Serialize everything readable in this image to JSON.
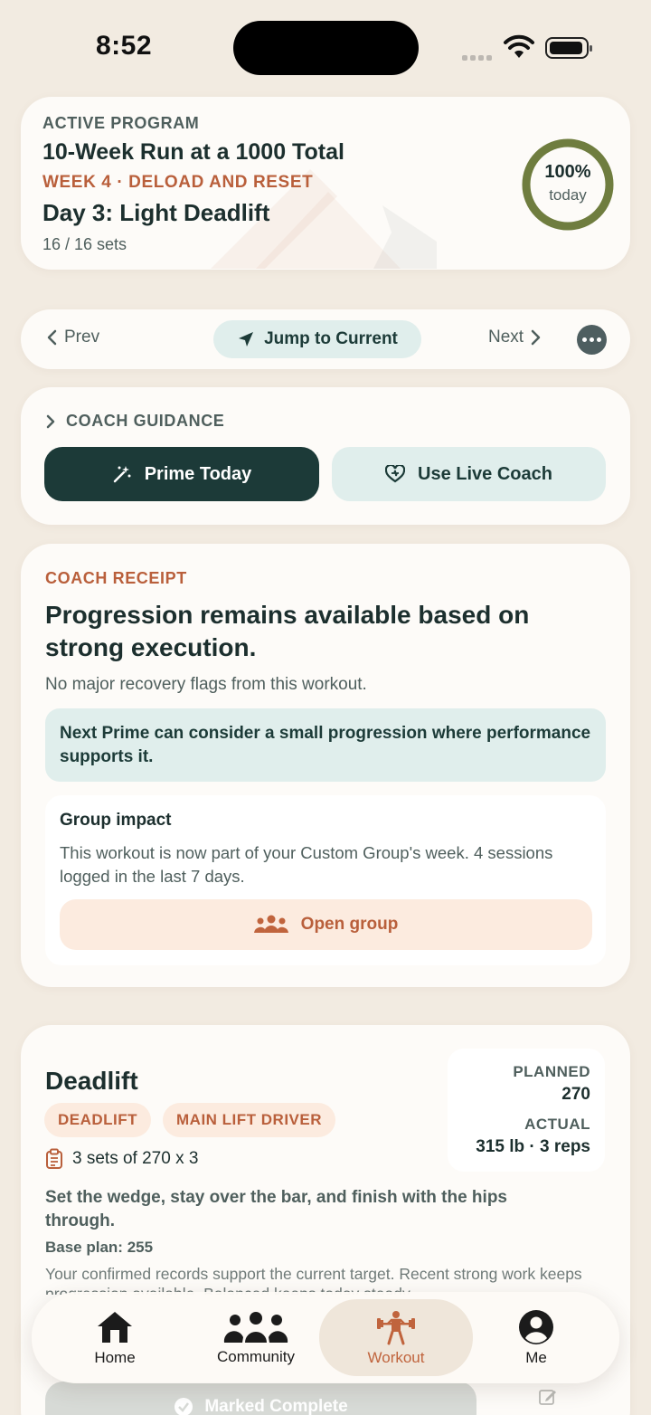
{
  "status_bar": {
    "time": "8:52"
  },
  "program": {
    "eyebrow": "ACTIVE PROGRAM",
    "title": "10-Week Run at a 1000 Total",
    "week": "WEEK 4 · DELOAD AND RESET",
    "day": "Day 3: Light Deadlift",
    "sets": "16 / 16 sets",
    "progress_pct_label": "100%",
    "progress_sub": "today",
    "progress_fraction": 1.0
  },
  "nav": {
    "prev": "Prev",
    "jump": "Jump to Current",
    "next": "Next"
  },
  "guidance": {
    "header": "COACH GUIDANCE",
    "prime_label": "Prime Today",
    "live_label": "Use Live Coach"
  },
  "receipt": {
    "eyebrow": "COACH RECEIPT",
    "title": "Progression remains available based on strong execution.",
    "subtitle": "No major recovery flags from this workout.",
    "note": "Next Prime can consider a small progression where performance supports it.",
    "group": {
      "title": "Group impact",
      "text": "This workout is now part of your Custom Group's week. 4 sessions logged in the last 7 days.",
      "button": "Open group"
    }
  },
  "exercise": {
    "name": "Deadlift",
    "tags": [
      "DEADLIFT",
      "MAIN LIFT DRIVER"
    ],
    "sets": "3 sets of 270 x 3",
    "cue": "Set the wedge, stay over the bar, and finish with the hips through.",
    "base_plan": "Base plan: 255",
    "note": "Your confirmed records support the current target. Recent strong work keeps progression available. Balanced keeps today steady.",
    "planned_label": "PLANNED",
    "planned_value": "270",
    "actual_label": "ACTUAL",
    "actual_value": "315 lb · 3 reps",
    "marked_complete": "Marked Complete"
  },
  "tabbar": {
    "home": "Home",
    "community": "Community",
    "workout": "Workout",
    "me": "Me",
    "active": "Workout"
  },
  "colors": {
    "accent": "#b95f3b",
    "dark_teal": "#1c3a38",
    "pale_teal": "#e0eeec",
    "ring_green": "#6f7d3f",
    "background": "#f2ebe1"
  }
}
